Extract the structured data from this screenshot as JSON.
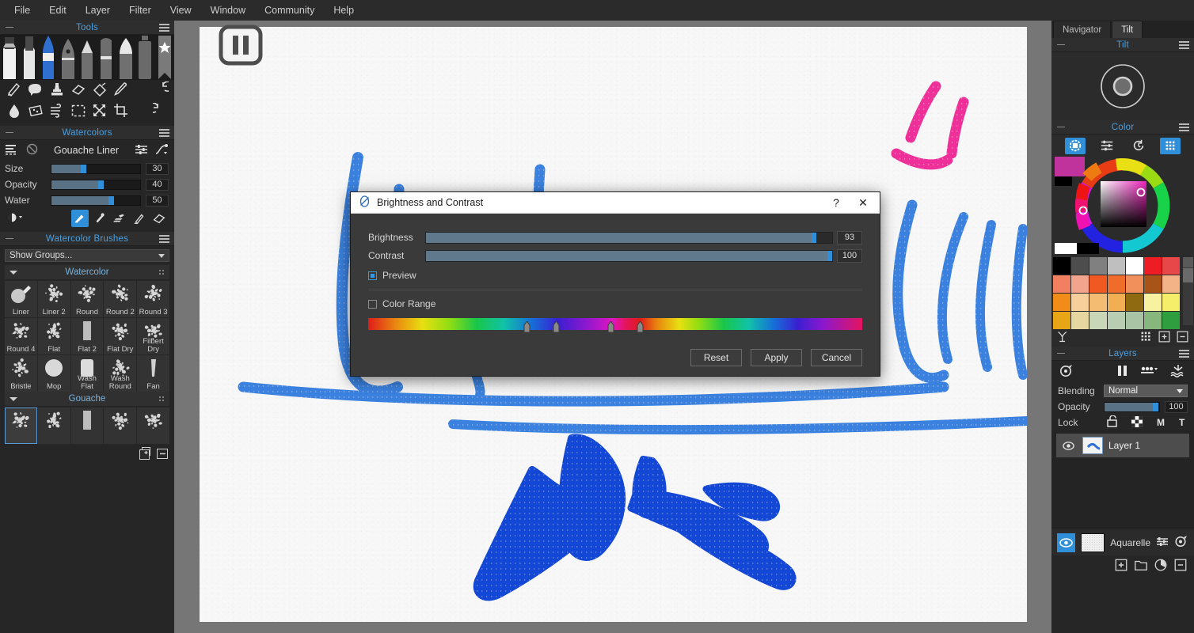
{
  "menubar": {
    "items": [
      {
        "label": "File"
      },
      {
        "label": "Edit"
      },
      {
        "label": "Layer"
      },
      {
        "label": "Filter"
      },
      {
        "label": "View"
      },
      {
        "label": "Window"
      },
      {
        "label": "Community"
      },
      {
        "label": "Help"
      }
    ]
  },
  "tools_panel": {
    "title": "Tools",
    "pen_tools": [
      "marker-tool",
      "brush-tool",
      "watercolor-brush-tool",
      "pen-nib-tool",
      "pencil-tool",
      "crayon-tool",
      "highlighter-tool",
      "spray-can-tool",
      "favorites-tool"
    ],
    "row1": [
      "smudge-icon",
      "blob-icon",
      "stamp-icon",
      "eraser-icon",
      "fill-bucket-icon",
      "eyedropper-icon"
    ],
    "row1_right": "undo-icon",
    "row2": [
      "water-drop-icon",
      "texture-icon",
      "blow-icon",
      "rect-select-icon",
      "transform-icon",
      "crop-icon"
    ],
    "row2_right": "redo-icon"
  },
  "watercolors_panel": {
    "title": "Watercolors",
    "brush_name": "Gouache Liner",
    "left_icons": [
      "presets-icon",
      "reset-icon"
    ],
    "right_icons": [
      "settings-sliders-icon",
      "curve-icon"
    ],
    "sliders": [
      {
        "label": "Size",
        "value": "30",
        "pct": 36
      },
      {
        "label": "Opacity",
        "value": "40",
        "pct": 55
      },
      {
        "label": "Water",
        "value": "50",
        "pct": 67
      }
    ],
    "blend_icon": "blend-mode-icon",
    "modes": [
      {
        "name": "paint-mode-icon",
        "selected": true
      },
      {
        "name": "wet-brush-mode-icon",
        "selected": false
      },
      {
        "name": "smear-mode-icon",
        "selected": false
      },
      {
        "name": "blend-mode-brush-icon",
        "selected": false
      },
      {
        "name": "eraser-mode-icon",
        "selected": false
      }
    ]
  },
  "brushes_panel": {
    "title": "Watercolor Brushes",
    "group_select": "Show Groups...",
    "groups": [
      {
        "name": "Watercolor",
        "brushes": [
          {
            "label": "Liner"
          },
          {
            "label": "Liner 2"
          },
          {
            "label": "Round"
          },
          {
            "label": "Round 2"
          },
          {
            "label": "Round 3"
          },
          {
            "label": "Round 4"
          },
          {
            "label": "Flat"
          },
          {
            "label": "Flat 2"
          },
          {
            "label": "Flat Dry"
          },
          {
            "label": "Filbert Dry"
          },
          {
            "label": "Bristle"
          },
          {
            "label": "Mop"
          },
          {
            "label": "Wash Flat"
          },
          {
            "label": "Wash Round"
          },
          {
            "label": "Fan"
          }
        ]
      },
      {
        "name": "Gouache",
        "brushes": [
          {
            "label": "",
            "selected": true
          },
          {
            "label": ""
          },
          {
            "label": ""
          },
          {
            "label": ""
          },
          {
            "label": ""
          }
        ]
      }
    ],
    "footer_icons": [
      "duplicate-brush-icon",
      "delete-brush-icon"
    ]
  },
  "canvas": {
    "overlay_badge": "pause-recording-badge",
    "paper_color": "#f7f7f7",
    "stroke_blue": "#3b82e0",
    "stroke_blue_dark": "#1347d6",
    "stroke_pink": "#f0309a"
  },
  "right_panel": {
    "tabs": [
      {
        "label": "Navigator",
        "active": false
      },
      {
        "label": "Tilt",
        "active": true
      }
    ],
    "tilt": {
      "title": "Tilt",
      "control": "tilt-joystick"
    },
    "color": {
      "title": "Color",
      "buttons": [
        {
          "name": "color-wheel-mode-icon",
          "active": true
        },
        {
          "name": "color-sliders-mode-icon",
          "active": false
        },
        {
          "name": "color-history-mode-icon",
          "active": false
        },
        {
          "name": "color-swatches-mode-icon",
          "active": true
        }
      ],
      "current_color": "#c0339c",
      "secondary_color": "#000000",
      "fg_white": "#ffffff",
      "bg_black": "#000000",
      "swatches": [
        [
          "#000000",
          "#4d4d4d",
          "#808080",
          "#bfbfbf",
          "#ffffff",
          "#ee1c25",
          "#e8474a"
        ],
        [
          "#f08060",
          "#f3a48c",
          "#f05a22",
          "#ef6c2a",
          "#f2905c",
          "#a85318",
          "#f3b387"
        ],
        [
          "#f28c18",
          "#f7cf9a",
          "#f4bb72",
          "#f2ae52",
          "#8f6a10",
          "#f7f1a0",
          "#f5ee6a"
        ],
        [
          "#e8a516",
          "#e6d6a0",
          "#c9d6b8",
          "#b9cdb2",
          "#a8c4a4",
          "#86b77c",
          "#2e9e3e"
        ]
      ],
      "footer_icons": [
        "color-mixer-icon",
        "swatch-grid-icon",
        "add-swatch-icon",
        "remove-swatch-icon"
      ]
    },
    "layers": {
      "title": "Layers",
      "toolbar_icons": [
        "layer-fx-icon",
        "pause-icon",
        "liquify-icon",
        "wet-layer-icon"
      ],
      "blending_label": "Blending",
      "blending_value": "Normal",
      "opacity_label": "Opacity",
      "opacity_value": "100",
      "opacity_pct": 93,
      "lock_label": "Lock",
      "lock_icons": [
        "lock-open-icon",
        "lock-transparency-icon"
      ],
      "lock_letters": [
        "M",
        "T"
      ],
      "items": [
        {
          "name": "Layer 1",
          "visible": true
        }
      ],
      "paper": {
        "name": "Aquarelle",
        "visible": true,
        "right_icons": [
          "paper-settings-icon",
          "paper-fx-icon"
        ]
      },
      "footer_icons": [
        "add-layer-icon",
        "add-group-icon",
        "adjustment-layer-icon",
        "delete-layer-icon"
      ]
    }
  },
  "dialog": {
    "icon": "brightness-contrast-icon",
    "title": "Brightness and Contrast",
    "help_button": "?",
    "close_button": "✕",
    "sliders": [
      {
        "label": "Brightness",
        "value": "93",
        "pct": 95.5
      },
      {
        "label": "Contrast",
        "value": "100",
        "pct": 99.5
      }
    ],
    "preview": {
      "label": "Preview",
      "checked": true
    },
    "color_range": {
      "label": "Color Range",
      "checked": false
    },
    "eyedropper_icon": "color-range-eyedropper-icon",
    "gradient_markers_pct": [
      32,
      38,
      49,
      55
    ],
    "buttons": [
      {
        "label": "Reset",
        "name": "reset-button"
      },
      {
        "label": "Apply",
        "name": "apply-button"
      },
      {
        "label": "Cancel",
        "name": "cancel-button"
      }
    ]
  }
}
